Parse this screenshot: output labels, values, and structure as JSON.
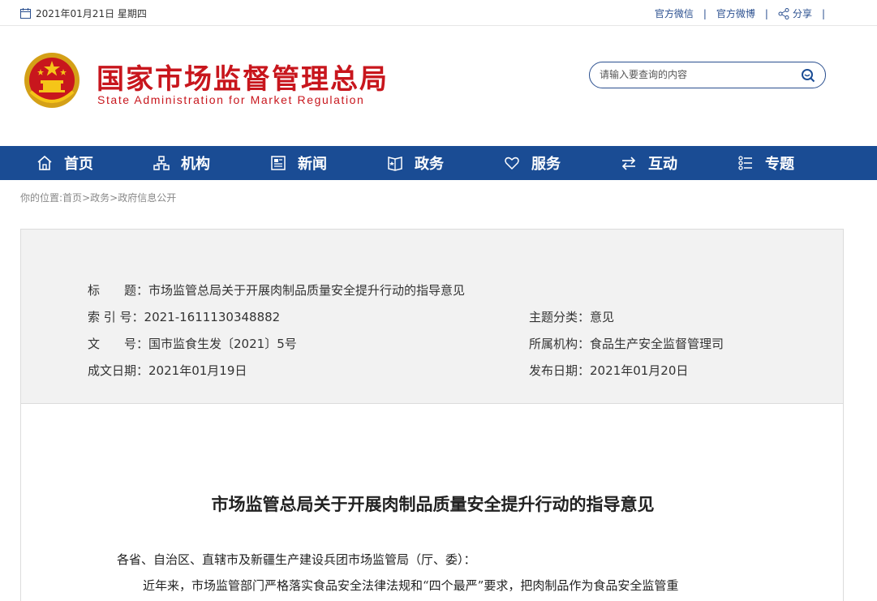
{
  "topbar": {
    "date": "2021年01月21日 星期四",
    "links": [
      "官方微信",
      "官方微博"
    ],
    "share_label": "分享"
  },
  "header": {
    "title_cn": "国家市场监督管理总局",
    "title_en": "State Administration for Market Regulation",
    "search_placeholder": "请输入要查询的内容"
  },
  "nav": {
    "items": [
      {
        "label": "首页",
        "icon": "home-icon"
      },
      {
        "label": "机构",
        "icon": "org-chart-icon"
      },
      {
        "label": "新闻",
        "icon": "newspaper-icon"
      },
      {
        "label": "政务",
        "icon": "book-icon"
      },
      {
        "label": "服务",
        "icon": "heart-icon"
      },
      {
        "label": "互动",
        "icon": "exchange-arrows-icon"
      },
      {
        "label": "专题",
        "icon": "list-icon"
      }
    ]
  },
  "breadcrumb": {
    "prefix": "你的位置:",
    "items": [
      "首页",
      "政务",
      "政府信息公开"
    ],
    "sep": ">"
  },
  "info": {
    "title_label": "标　　题：",
    "title_value": "市场监管总局关于开展肉制品质量安全提升行动的指导意见",
    "index_label": "索 引 号：",
    "index_value": "2021-1611130348882",
    "topic_label": "主题分类：",
    "topic_value": "意见",
    "docno_label": "文　　号：",
    "docno_value": "国市监食生发〔2021〕5号",
    "org_label": "所属机构：",
    "org_value": "食品生产安全监督管理司",
    "created_label": "成文日期：",
    "created_value": "2021年01月19日",
    "published_label": "发布日期：",
    "published_value": "2021年01月20日"
  },
  "article": {
    "title": "市场监管总局关于开展肉制品质量安全提升行动的指导意见",
    "salutation": "各省、自治区、直辖市及新疆生产建设兵团市场监管局（厅、委）：",
    "p1": "近年来，市场监管部门严格落实食品安全法律法规和“四个最严”要求，把肉制品作为食品安全监管重"
  },
  "colors": {
    "brand_red": "#c8161d",
    "nav_blue": "#1a4c94",
    "link_blue": "#2a4f8f"
  }
}
